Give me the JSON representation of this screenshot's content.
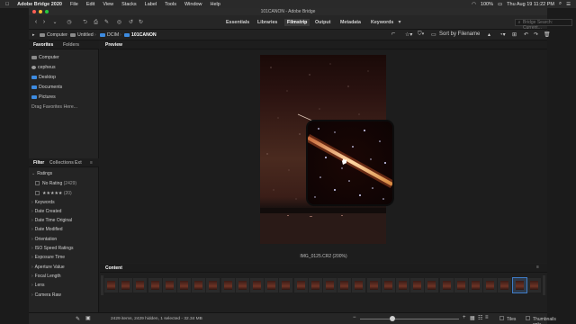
{
  "menubar": {
    "app": "Adobe Bridge 2020",
    "items": [
      "File",
      "Edit",
      "View",
      "Stacks",
      "Label",
      "Tools",
      "Window",
      "Help"
    ],
    "battery": "100%",
    "clock": "Thu Aug 19  11:22 PM"
  },
  "window": {
    "title": "101CANON - Adobe Bridge"
  },
  "toolbar": {
    "workspaces": [
      "Essentials",
      "Libraries",
      "Filmstrip",
      "Output",
      "Metadata",
      "Keywords"
    ],
    "active_workspace": "Filmstrip",
    "search_placeholder": "Bridge Search: Current..."
  },
  "path": {
    "crumbs": [
      "Computer",
      "Untitled",
      "DCIM",
      "101CANON"
    ],
    "sort_label": "Sort by Filename"
  },
  "left": {
    "tabs": [
      "Favorites",
      "Folders"
    ],
    "favorites": [
      "Computer",
      "cepheus",
      "Desktop",
      "Documents",
      "Pictures"
    ],
    "drag_hint": "Drag Favorites Here...",
    "filter_tabs": [
      "Filter",
      "Collections",
      "Ext"
    ],
    "ratings_header": "Ratings",
    "no_rating_label": "No Rating",
    "no_rating_count": "(2429)",
    "five_star_stars": "★★★★★",
    "five_star_count": "(20)",
    "filter_sections": [
      "Keywords",
      "Date Created",
      "Date Time Original",
      "Date Modified",
      "Orientation",
      "ISO Speed Ratings",
      "Exposure Time",
      "Aperture Value",
      "Focal Length",
      "Lens",
      "Camera Raw"
    ]
  },
  "preview": {
    "tab": "Preview",
    "caption": "IMG_0125.CR2 (200%)"
  },
  "content": {
    "tab": "Content",
    "thumb_count": 30,
    "selected_index": 28
  },
  "status": {
    "text": "2429 items, 2429 hidden, 1 selected - 32.34 MB",
    "tiles_label": "Tiles",
    "thumbs_only_label": "Thumbnails only"
  },
  "colors": {
    "accent": "#3f7cc7",
    "folder": "#3d8be0"
  }
}
